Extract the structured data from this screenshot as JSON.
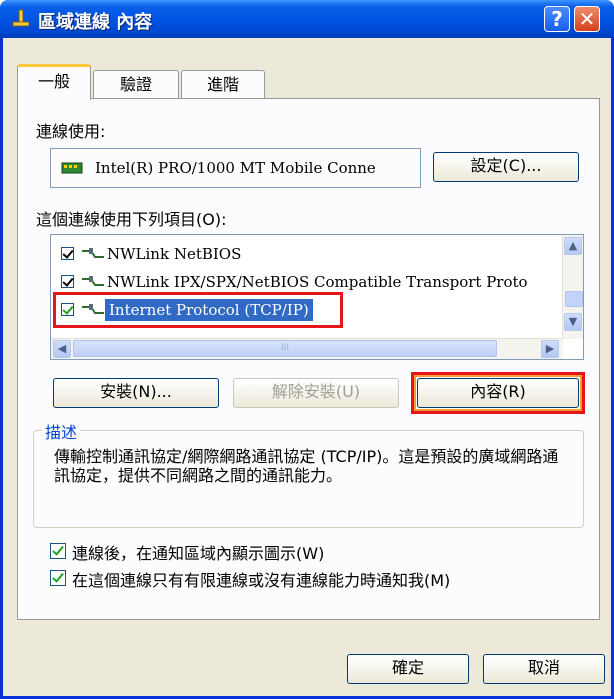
{
  "window": {
    "title": "區域連線 內容",
    "help_symbol": "?",
    "close_symbol": "✕"
  },
  "tabs": [
    {
      "label": "一般",
      "selected": true
    },
    {
      "label": "驗證",
      "selected": false
    },
    {
      "label": "進階",
      "selected": false
    }
  ],
  "connect_using": {
    "label": "連線使用:",
    "adapter": "Intel(R) PRO/1000 MT Mobile Conne",
    "configure_label": "設定(C)..."
  },
  "items": {
    "label": "這個連線使用下列項目(O):",
    "list": [
      {
        "checked": true,
        "name": "NWLink NetBIOS"
      },
      {
        "checked": true,
        "name": "NWLink IPX/SPX/NetBIOS Compatible Transport Proto"
      },
      {
        "checked": true,
        "name": "Internet Protocol (TCP/IP)",
        "selected": true
      }
    ],
    "scrollbar_grip": "III"
  },
  "actions": {
    "install_label": "安裝(N)...",
    "uninstall_label": "解除安裝(U)",
    "properties_label": "內容(R)"
  },
  "description": {
    "title": "描述",
    "text": "傳輸控制通訊協定/網際網路通訊協定 (TCP/IP)。這是預設的廣域網路通訊協定，提供不同網路之間的通訊能力。"
  },
  "options": [
    {
      "label": "連線後，在通知區域內顯示圖示(W)",
      "checked": true
    },
    {
      "label": "在這個連線只有有限連線或沒有連線能力時通知我(M)",
      "checked": true
    }
  ],
  "footer": {
    "ok_label": "確定",
    "cancel_label": "取消"
  },
  "colors": {
    "title_bar": "#0054e3",
    "selection": "#316ac5",
    "highlight_red": "#e8141c",
    "highlight_orange": "#f0a030",
    "group_title": "#0046d5"
  }
}
